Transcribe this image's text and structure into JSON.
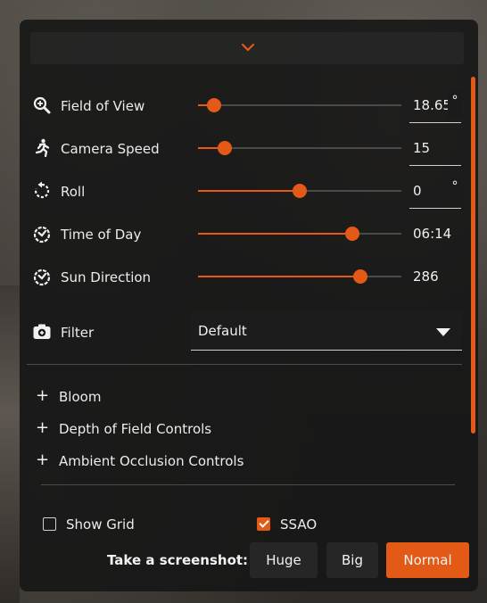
{
  "controls": [
    {
      "label": "Field of View",
      "icon": "zoom-icon",
      "value": "18.65",
      "unit": "°",
      "slider": 0.08
    },
    {
      "label": "Camera Speed",
      "icon": "running-person-icon",
      "value": "15",
      "unit": "",
      "slider": 0.13
    },
    {
      "label": "Roll",
      "icon": "rotate-icon",
      "value": "0",
      "unit": "°",
      "slider": 0.5
    },
    {
      "label": "Time of Day",
      "icon": "timer-icon",
      "value": "06:14",
      "unit": "",
      "slider": 0.76
    },
    {
      "label": "Sun Direction",
      "icon": "timer-icon",
      "value": "286",
      "unit": "",
      "slider": 0.8
    }
  ],
  "filter": {
    "label": "Filter",
    "icon": "camera-icon",
    "selected": "Default"
  },
  "sections": [
    "Bloom",
    "Depth of Field Controls",
    "Ambient Occlusion Controls"
  ],
  "toggles": {
    "show_grid": {
      "label": "Show Grid",
      "checked": false
    },
    "ssao": {
      "label": "SSAO",
      "checked": true
    }
  },
  "screenshot": {
    "label": "Take a screenshot:",
    "buttons": [
      "Huge",
      "Big",
      "Normal"
    ],
    "active": "Normal"
  },
  "colors": {
    "accent": "#e35a16",
    "panel": "#161616"
  }
}
